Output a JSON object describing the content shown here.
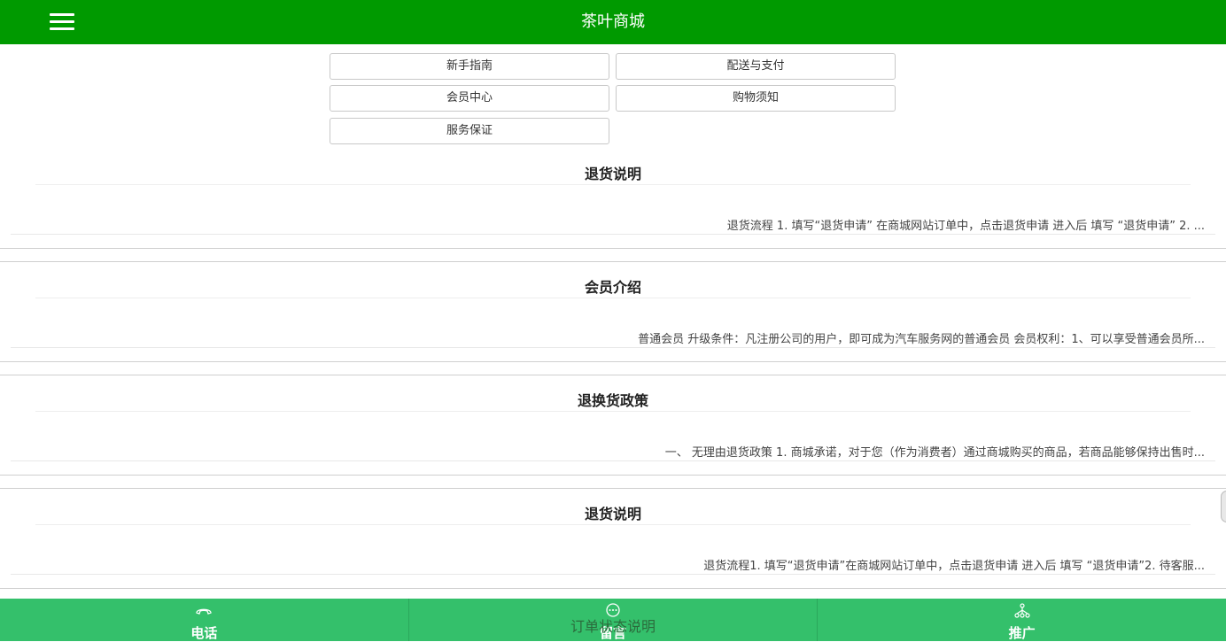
{
  "header": {
    "title": "茶叶商城",
    "menu_icon": "hamburger-menu-icon"
  },
  "categories": [
    {
      "label": "新手指南"
    },
    {
      "label": "配送与支付"
    },
    {
      "label": "会员中心"
    },
    {
      "label": "购物须知"
    },
    {
      "label": "服务保证"
    }
  ],
  "articles": [
    {
      "title": "退货说明",
      "summary": "退货流程 1. 填写“退货申请” 在商城网站订单中，点击退货申请 进入后 填写 “退货申请” 2. ..."
    },
    {
      "title": "会员介绍",
      "summary": "普通会员 升级条件：凡注册公司的用户，即可成为汽车服务网的普通会员 会员权利：1、可以享受普通会员所..."
    },
    {
      "title": "退换货政策",
      "summary": "一、 无理由退货政策 1. 商城承诺，对于您（作为消费者）通过商城购买的商品，若商品能够保持出售时..."
    },
    {
      "title": "退货说明",
      "summary": "退货流程1. 填写“退货申请”在商城网站订单中，点击退货申请 进入后 填写 “退货申请”2. 待客服..."
    }
  ],
  "overlay_text": "订单状态说明",
  "bottom_nav": [
    {
      "label": "电话",
      "icon": "phone-icon"
    },
    {
      "label": "留言",
      "icon": "message-icon"
    },
    {
      "label": "推广",
      "icon": "share-network-icon"
    }
  ],
  "colors": {
    "header_bg": "#009a00",
    "bottom_bar_bg": "#34c06b"
  }
}
